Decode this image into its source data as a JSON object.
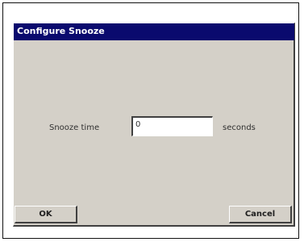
{
  "dialog": {
    "title": "Configure Snooze",
    "snooze_label": "Snooze time",
    "snooze_value": "0",
    "unit_label": "seconds",
    "ok_label": "OK",
    "cancel_label": "Cancel"
  },
  "colors": {
    "titlebar": "#0a0a6e",
    "dialog_background": "#d4d0c8"
  }
}
